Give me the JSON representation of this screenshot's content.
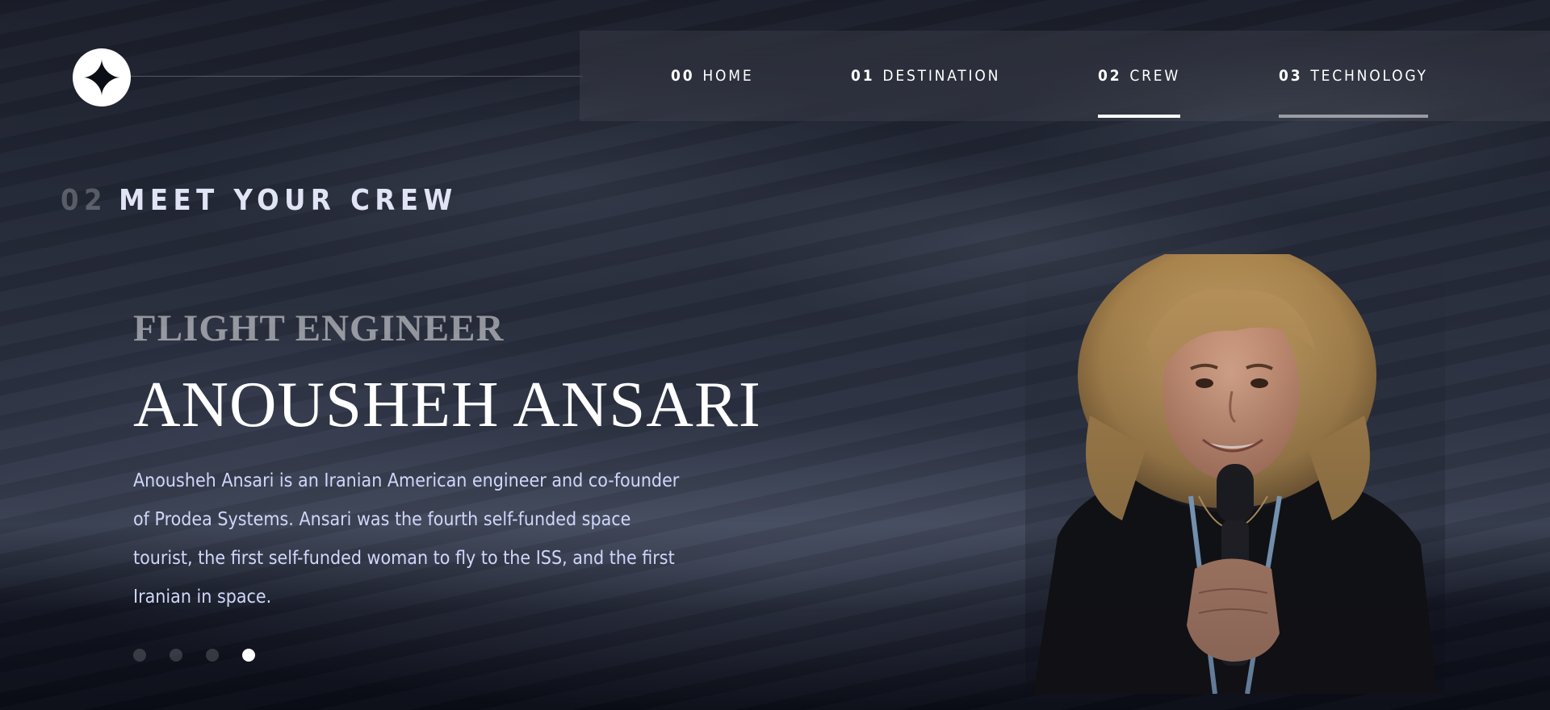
{
  "nav": {
    "items": [
      {
        "num": "00",
        "label": "HOME"
      },
      {
        "num": "01",
        "label": "DESTINATION"
      },
      {
        "num": "02",
        "label": "CREW"
      },
      {
        "num": "03",
        "label": "TECHNOLOGY"
      }
    ],
    "active_index": 2
  },
  "section": {
    "num": "02",
    "title": "MEET YOUR CREW"
  },
  "crew": {
    "role": "FLIGHT ENGINEER",
    "name": "ANOUSHEH ANSARI",
    "bio": "Anousheh Ansari is an Iranian American engineer and co-founder of Prodea Systems. Ansari was the fourth self-funded space tourist, the first self-funded woman to fly to the ISS, and the first Iranian in space.",
    "slides": 4,
    "active_slide": 4
  },
  "icons": {
    "logo": "four-point-star-icon"
  },
  "colors": {
    "background": "#0b0d17",
    "accent_text": "#d0d6f9",
    "white": "#ffffff"
  }
}
